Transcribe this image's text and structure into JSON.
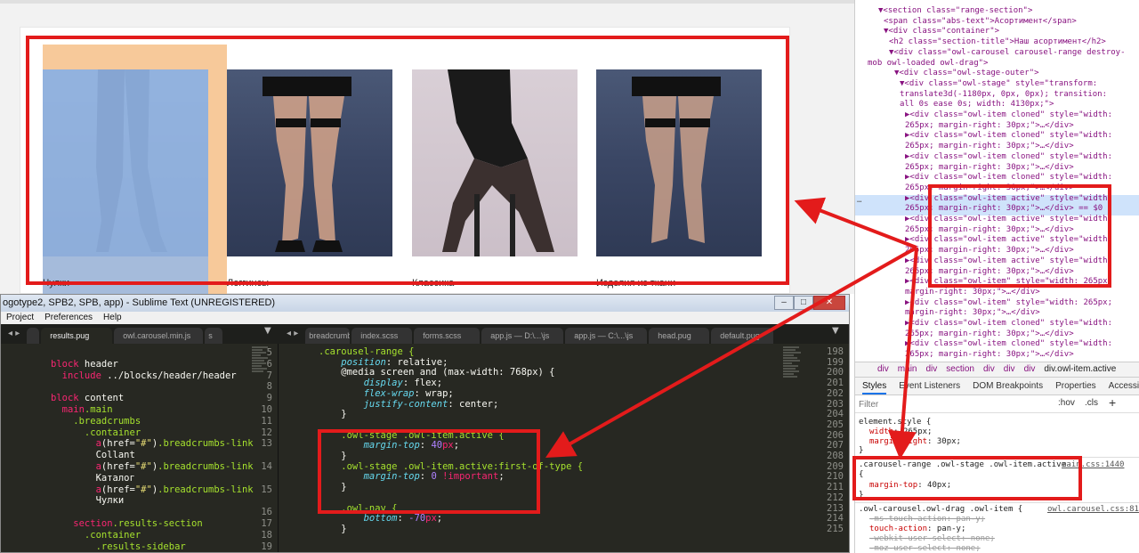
{
  "browser": {
    "products": [
      {
        "caption": "Чулки"
      },
      {
        "caption": "Леггинсы"
      },
      {
        "caption": "Классика"
      },
      {
        "caption": "Изделия из ткани"
      }
    ]
  },
  "sublime": {
    "title": "ogotype2, SPB2, SPB, app) - Sublime Text (UNREGISTERED)",
    "menu": [
      "Project",
      "Preferences",
      "Help"
    ],
    "left_tabs": [
      "results.pug",
      "owl.carousel.min.js",
      "s"
    ],
    "right_tabs": [
      "breadcrumb",
      "index.scss",
      "forms.scss",
      "app.js — D:\\...\\js",
      "app.js — C:\\...\\js",
      "head.pug",
      "default.pug"
    ],
    "left_lines": [
      {
        "n": "5",
        "tokens": []
      },
      {
        "n": "6",
        "tokens": [
          {
            "t": "block",
            "c": "kw"
          },
          {
            "t": " header",
            "c": "white"
          }
        ]
      },
      {
        "n": "7",
        "tokens": [
          {
            "t": "  include",
            "c": "kw"
          },
          {
            "t": " ../blocks/header/header",
            "c": "white"
          }
        ]
      },
      {
        "n": "8",
        "tokens": []
      },
      {
        "n": "9",
        "tokens": [
          {
            "t": "block",
            "c": "kw"
          },
          {
            "t": " content",
            "c": "white"
          }
        ]
      },
      {
        "n": "10",
        "tokens": [
          {
            "t": "  main",
            "c": "tag"
          },
          {
            "t": ".main",
            "c": "cls"
          }
        ]
      },
      {
        "n": "11",
        "tokens": [
          {
            "t": "    .breadcrumbs",
            "c": "cls"
          }
        ]
      },
      {
        "n": "12",
        "tokens": [
          {
            "t": "      .container",
            "c": "cls"
          }
        ]
      },
      {
        "n": "13",
        "tokens": [
          {
            "t": "        a",
            "c": "tag"
          },
          {
            "t": "(href=",
            "c": "white"
          },
          {
            "t": "\"#\"",
            "c": "str"
          },
          {
            "t": ")",
            "c": "white"
          },
          {
            "t": ".breadcrumbs-link",
            "c": "cls"
          }
        ]
      },
      {
        "n": "",
        "tokens": [
          {
            "t": "        Collant",
            "c": "white"
          }
        ]
      },
      {
        "n": "14",
        "tokens": [
          {
            "t": "        a",
            "c": "tag"
          },
          {
            "t": "(href=",
            "c": "white"
          },
          {
            "t": "\"#\"",
            "c": "str"
          },
          {
            "t": ")",
            "c": "white"
          },
          {
            "t": ".breadcrumbs-link",
            "c": "cls"
          }
        ]
      },
      {
        "n": "",
        "tokens": [
          {
            "t": "        Каталог",
            "c": "white"
          }
        ]
      },
      {
        "n": "15",
        "tokens": [
          {
            "t": "        a",
            "c": "tag"
          },
          {
            "t": "(href=",
            "c": "white"
          },
          {
            "t": "\"#\"",
            "c": "str"
          },
          {
            "t": ")",
            "c": "white"
          },
          {
            "t": ".breadcrumbs-link",
            "c": "cls"
          }
        ]
      },
      {
        "n": "",
        "tokens": [
          {
            "t": "        Чулки",
            "c": "white"
          }
        ]
      },
      {
        "n": "16",
        "tokens": []
      },
      {
        "n": "17",
        "tokens": [
          {
            "t": "    section",
            "c": "tag"
          },
          {
            "t": ".results-section",
            "c": "cls"
          }
        ]
      },
      {
        "n": "18",
        "tokens": [
          {
            "t": "      .container",
            "c": "cls"
          }
        ]
      },
      {
        "n": "19",
        "tokens": [
          {
            "t": "        .results-sidebar",
            "c": "cls"
          }
        ]
      }
    ],
    "right_lines": [
      {
        "n": "198",
        "tokens": [
          {
            "t": ".carousel-range {",
            "c": "cls"
          }
        ]
      },
      {
        "n": "199",
        "tokens": [
          {
            "t": "    position",
            "c": "prop"
          },
          {
            "t": ": relative;",
            "c": "white"
          }
        ]
      },
      {
        "n": "200",
        "tokens": [
          {
            "t": "    @media",
            "c": "white"
          },
          {
            "t": " screen and (max-width: 768px) {",
            "c": "white"
          }
        ]
      },
      {
        "n": "201",
        "tokens": [
          {
            "t": "        display",
            "c": "prop"
          },
          {
            "t": ": flex;",
            "c": "white"
          }
        ]
      },
      {
        "n": "202",
        "tokens": [
          {
            "t": "        flex-wrap",
            "c": "prop"
          },
          {
            "t": ": wrap;",
            "c": "white"
          }
        ]
      },
      {
        "n": "203",
        "tokens": [
          {
            "t": "        justify-content",
            "c": "prop"
          },
          {
            "t": ": center;",
            "c": "white"
          }
        ]
      },
      {
        "n": "204",
        "tokens": [
          {
            "t": "    }",
            "c": "white"
          }
        ]
      },
      {
        "n": "205",
        "tokens": []
      },
      {
        "n": "206",
        "tokens": [
          {
            "t": "    .owl-stage .owl-item.active {",
            "c": "cls"
          }
        ]
      },
      {
        "n": "207",
        "tokens": [
          {
            "t": "        margin-top",
            "c": "prop"
          },
          {
            "t": ": ",
            "c": "white"
          },
          {
            "t": "40",
            "c": "num"
          },
          {
            "t": "px",
            "c": "kw"
          },
          {
            "t": ";",
            "c": "white"
          }
        ]
      },
      {
        "n": "208",
        "tokens": [
          {
            "t": "    }",
            "c": "white"
          }
        ]
      },
      {
        "n": "209",
        "tokens": [
          {
            "t": "    .owl-stage .owl-item.active:first-of-type {",
            "c": "cls"
          }
        ]
      },
      {
        "n": "210",
        "tokens": [
          {
            "t": "        margin-top",
            "c": "prop"
          },
          {
            "t": ": ",
            "c": "white"
          },
          {
            "t": "0",
            "c": "num"
          },
          {
            "t": " !important",
            "c": "kw"
          },
          {
            "t": ";",
            "c": "white"
          }
        ]
      },
      {
        "n": "211",
        "tokens": [
          {
            "t": "    }",
            "c": "white"
          }
        ]
      },
      {
        "n": "212",
        "tokens": []
      },
      {
        "n": "213",
        "tokens": [
          {
            "t": "    .owl-nav {",
            "c": "cls"
          }
        ]
      },
      {
        "n": "214",
        "tokens": [
          {
            "t": "        bottom",
            "c": "prop"
          },
          {
            "t": ": ",
            "c": "white"
          },
          {
            "t": "-70",
            "c": "num"
          },
          {
            "t": "px",
            "c": "kw"
          },
          {
            "t": ";",
            "c": "white"
          }
        ]
      },
      {
        "n": "215",
        "tokens": [
          {
            "t": "    }",
            "c": "white"
          }
        ]
      }
    ]
  },
  "devtools": {
    "elements": [
      {
        "indent": 3,
        "html": "▼<section class=\"range-section\">"
      },
      {
        "indent": 4,
        "html": "<span class=\"abs-text\">Асортимент</span>"
      },
      {
        "indent": 4,
        "html": "▼<div class=\"container\">"
      },
      {
        "indent": 5,
        "html": "<h2 class=\"section-title\">Наш асортимент</h2>"
      },
      {
        "indent": 5,
        "html": "▼<div class=\"owl-carousel carousel-range destroy-"
      },
      {
        "indent": 1,
        "html": "mob owl-loaded owl-drag\">"
      },
      {
        "indent": 6,
        "html": "▼<div class=\"owl-stage-outer\">"
      },
      {
        "indent": 7,
        "html": "▼<div class=\"owl-stage\" style=\"transform:"
      },
      {
        "indent": 7,
        "html": "translate3d(-1180px, 0px, 0px); transition:"
      },
      {
        "indent": 7,
        "html": "all 0s ease 0s; width: 4130px;\">"
      },
      {
        "indent": 8,
        "html": "▶<div class=\"owl-item cloned\" style=\"width:"
      },
      {
        "indent": 8,
        "html": "265px; margin-right: 30px;\">…</div>"
      },
      {
        "indent": 8,
        "html": "▶<div class=\"owl-item cloned\" style=\"width:"
      },
      {
        "indent": 8,
        "html": "265px; margin-right: 30px;\">…</div>"
      },
      {
        "indent": 8,
        "html": "▶<div class=\"owl-item cloned\" style=\"width:"
      },
      {
        "indent": 8,
        "html": "265px; margin-right: 30px;\">…</div>"
      },
      {
        "indent": 8,
        "html": "▶<div class=\"owl-item cloned\" style=\"width:"
      },
      {
        "indent": 8,
        "html": "265px; margin-right: 30px;\">…</div>"
      },
      {
        "indent": 8,
        "html": "▶<div class=\"owl-item active\" style=\"width:"
      },
      {
        "indent": 8,
        "html": "265px; margin-right: 30px;\">…</div> == $0"
      },
      {
        "indent": 8,
        "html": "▶<div class=\"owl-item active\" style=\"width:"
      },
      {
        "indent": 8,
        "html": "265px; margin-right: 30px;\">…</div>"
      },
      {
        "indent": 8,
        "html": "▶<div class=\"owl-item active\" style=\"width:"
      },
      {
        "indent": 8,
        "html": "265px; margin-right: 30px;\">…</div>"
      },
      {
        "indent": 8,
        "html": "▶<div class=\"owl-item active\" style=\"width:"
      },
      {
        "indent": 8,
        "html": "265px; margin-right: 30px;\">…</div>"
      },
      {
        "indent": 8,
        "html": "▶<div class=\"owl-item\" style=\"width: 265px;"
      },
      {
        "indent": 8,
        "html": "margin-right: 30px;\">…</div>"
      },
      {
        "indent": 8,
        "html": "▶<div class=\"owl-item\" style=\"width: 265px;"
      },
      {
        "indent": 8,
        "html": "margin-right: 30px;\">…</div>"
      },
      {
        "indent": 8,
        "html": "▶<div class=\"owl-item cloned\" style=\"width:"
      },
      {
        "indent": 8,
        "html": "265px; margin-right: 30px;\">…</div>"
      },
      {
        "indent": 8,
        "html": "▶<div class=\"owl-item cloned\" style=\"width:"
      },
      {
        "indent": 8,
        "html": "265px; margin-right: 30px;\">…</div>"
      }
    ],
    "ellipsis": "…",
    "breadcrumb": [
      "div",
      "main",
      "div",
      "section",
      "div",
      "div",
      "div",
      "div.owl-item.active"
    ],
    "tabs": [
      "Styles",
      "Event Listeners",
      "DOM Breakpoints",
      "Properties",
      "Accessibility"
    ],
    "filter_placeholder": "Filter",
    "hov": ":hov",
    "cls": ".cls",
    "plus": "+",
    "styles": {
      "element_style": "element.style {",
      "el_props": [
        {
          "p": "width",
          "v": "265px;"
        },
        {
          "p": "margin-right",
          "v": "30px;"
        }
      ],
      "rule1_selector": ".carousel-range .owl-stage .owl-item.active",
      "rule1_source": "main.css:1440",
      "rule1_open": "{",
      "rule1_props": [
        {
          "p": "margin-top",
          "v": "40px;"
        }
      ],
      "rule2_selector": ".owl-carousel.owl-drag .owl-item {",
      "rule2_source": "owl.carousel.css:81",
      "rule2_props": [
        {
          "p": "-ms-touch-action",
          "v": "pan-y;",
          "strike": true
        },
        {
          "p": "touch-action",
          "v": "pan-y;",
          "strike": false
        },
        {
          "p": "-webkit-user-select",
          "v": "none;",
          "strike": true
        },
        {
          "p": "-moz-user-select",
          "v": "none;",
          "strike": true
        }
      ],
      "close": "}"
    }
  },
  "colors": {
    "annotation": "#e31b1b",
    "editor_bg": "#272822",
    "selection": "#cfe3fb"
  }
}
